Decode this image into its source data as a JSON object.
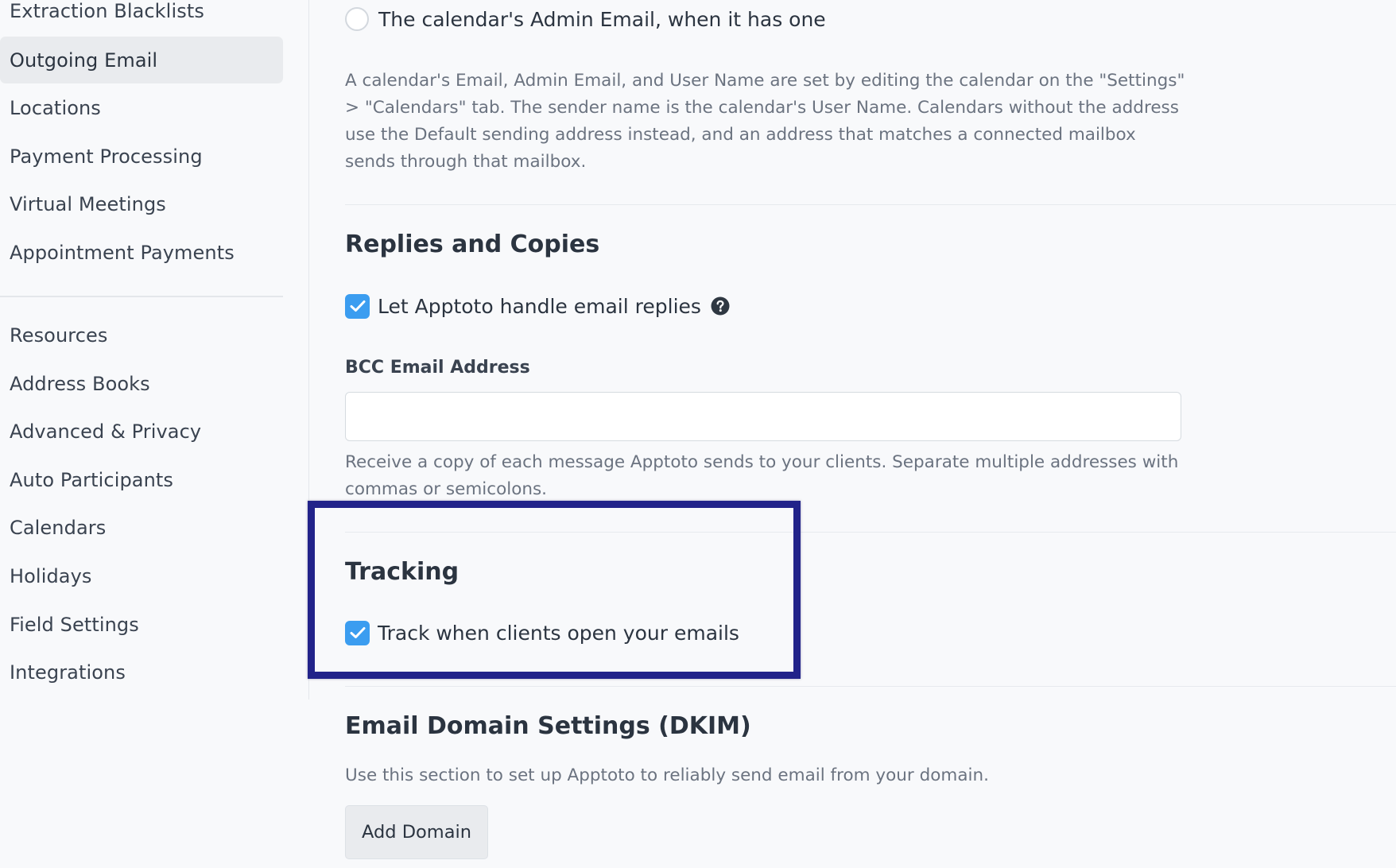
{
  "sidebar": {
    "items": [
      {
        "label": "Extraction Blacklists",
        "active": false
      },
      {
        "label": "Outgoing Email",
        "active": true
      },
      {
        "label": "Locations",
        "active": false
      },
      {
        "label": "Payment Processing",
        "active": false
      },
      {
        "label": "Virtual Meetings",
        "active": false
      },
      {
        "label": "Appointment Payments",
        "active": false
      },
      {
        "label": "Resources",
        "active": false
      },
      {
        "label": "Address Books",
        "active": false
      },
      {
        "label": "Advanced & Privacy",
        "active": false
      },
      {
        "label": "Auto Participants",
        "active": false
      },
      {
        "label": "Calendars",
        "active": false
      },
      {
        "label": "Holidays",
        "active": false
      },
      {
        "label": "Field Settings",
        "active": false
      },
      {
        "label": "Integrations",
        "active": false
      }
    ]
  },
  "sender": {
    "radio_option_label": "The calendar's Admin Email, when it has one",
    "radio_selected": false,
    "help_text": "A calendar's Email, Admin Email, and User Name are set by editing the calendar on the \"Settings\" > \"Calendars\" tab. The sender name is the calendar's User Name. Calendars without the address use the Default sending address instead, and an address that matches a connected mailbox sends through that mailbox."
  },
  "replies": {
    "heading": "Replies and Copies",
    "handle_replies_label": "Let Apptoto handle email replies",
    "handle_replies_checked": true,
    "bcc_label": "BCC Email Address",
    "bcc_value": "",
    "bcc_placeholder": "",
    "bcc_help": "Receive a copy of each message Apptoto sends to your clients. Separate multiple addresses with commas or semicolons."
  },
  "tracking": {
    "heading": "Tracking",
    "track_opens_label": "Track when clients open your emails",
    "track_opens_checked": true
  },
  "dkim": {
    "heading": "Email Domain Settings (DKIM)",
    "description": "Use this section to set up Apptoto to reliably send email from your domain.",
    "add_domain_label": "Add Domain"
  },
  "colors": {
    "checkbox_blue": "#3b9df0",
    "highlight_navy": "#22238a",
    "active_nav_bg": "#e9ebee"
  }
}
